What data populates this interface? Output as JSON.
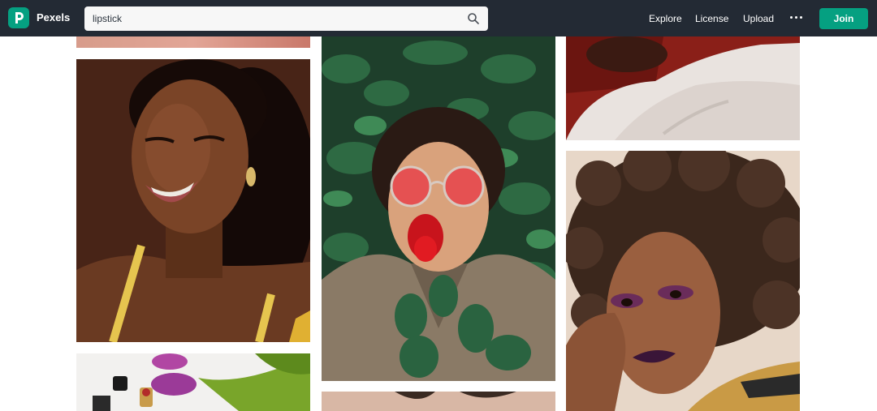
{
  "brand": {
    "name": "Pexels",
    "logo_icon": "pexels-logo-icon",
    "accent": "#05a081"
  },
  "search": {
    "value": "lipstick",
    "icon": "search-icon"
  },
  "nav": {
    "explore": "Explore",
    "license": "License",
    "upload": "Upload",
    "more_icon": "more-horizontal-icon",
    "join": "Join"
  },
  "colors": {
    "navbar": "#232a34",
    "background": "#ffffff"
  },
  "photos": [
    {
      "subject": "photo-top-partial-left"
    },
    {
      "subject": "photo-woman-smiling-braces"
    },
    {
      "subject": "photo-tulips-lipstick"
    },
    {
      "subject": "photo-woman-red-glasses-leaves"
    },
    {
      "subject": "photo-bottom-partial-center"
    },
    {
      "subject": "photo-fur-coat-partial"
    },
    {
      "subject": "photo-woman-curly-hair-dark-lips"
    }
  ]
}
